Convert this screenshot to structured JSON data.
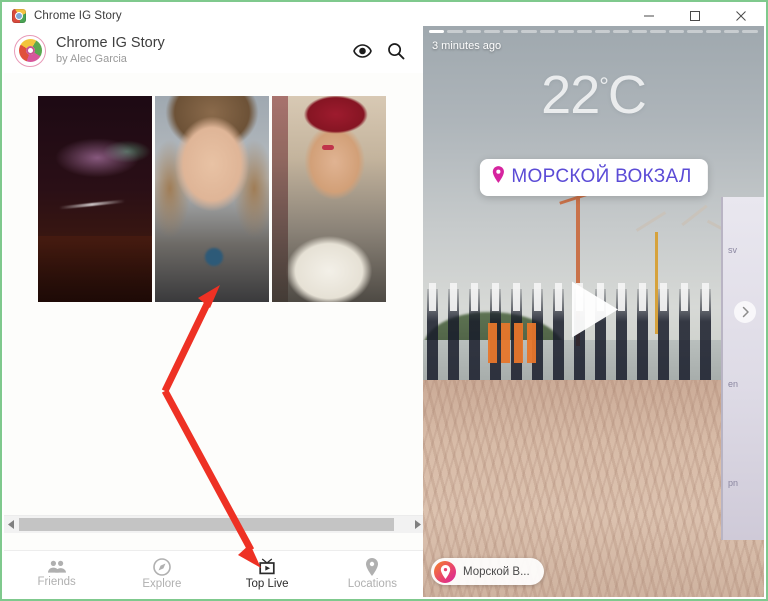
{
  "window": {
    "title": "Chrome IG Story",
    "app_icon": "chrome-ig-story-icon",
    "controls": {
      "minimize": "minimize-icon",
      "maximize": "maximize-icon",
      "close": "close-icon"
    },
    "border_color": "#7fc98d"
  },
  "app_header": {
    "logo": "chrome-ig-story-logo",
    "title": "Chrome IG Story",
    "subtitle": "by Alec Garcia",
    "actions": [
      {
        "name": "eye-icon",
        "label": "Seen"
      },
      {
        "name": "search-icon",
        "label": "Search"
      }
    ]
  },
  "thumbnails": [
    {
      "name": "story-thumbnail-1",
      "alt": "Dark night stage scene"
    },
    {
      "name": "story-thumbnail-2",
      "alt": "Young woman selfie video"
    },
    {
      "name": "story-thumbnail-3",
      "alt": "Woman with red cap and white scarf"
    }
  ],
  "scrollbar": {
    "left_arrow": "scroll-left-icon",
    "right_arrow": "scroll-right-icon",
    "thumb_percent": 96
  },
  "tabbar": {
    "items": [
      {
        "id": "friends",
        "label": "Friends",
        "icon": "people-icon",
        "active": false
      },
      {
        "id": "explore",
        "label": "Explore",
        "icon": "compass-icon",
        "active": false
      },
      {
        "id": "top-live",
        "label": "Top Live",
        "icon": "tv-play-icon",
        "active": true
      },
      {
        "id": "locations",
        "label": "Locations",
        "icon": "map-pin-icon",
        "active": false
      }
    ],
    "active_color": "#2b2b2b",
    "inactive_color": "#b0b0b0"
  },
  "story": {
    "progress": {
      "segments": 18,
      "active_index": 0
    },
    "timestamp": "3 minutes ago",
    "temperature": {
      "value": "22",
      "degree": "°",
      "unit": "C"
    },
    "location_sticker": {
      "text": "МОРСКОЙ ВОКЗАЛ",
      "pin_icon": "map-pin-icon",
      "text_color": "#5b4bd6"
    },
    "play_button": "play-icon",
    "next_button": "chevron-right-icon",
    "location_chip": {
      "text": "Морской В...",
      "pin_icon": "location-pin-icon"
    }
  },
  "annotation": {
    "name": "red-double-arrow",
    "color": "#ee3124",
    "description": "Double-headed red arrow pointing from the story thumbnails down to the Top Live tab"
  }
}
